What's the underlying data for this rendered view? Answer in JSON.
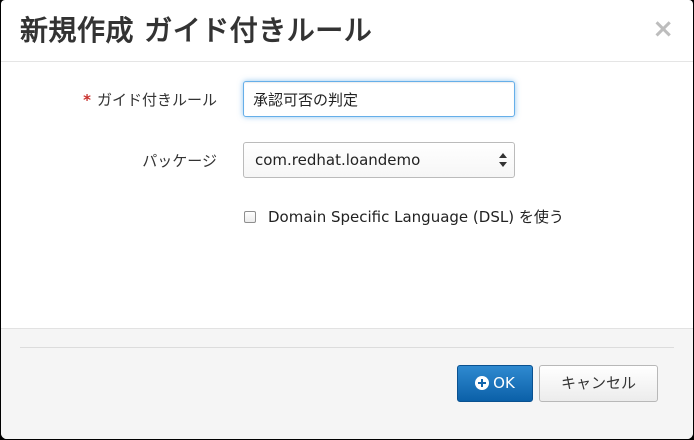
{
  "dialog": {
    "title": "新規作成 ガイド付きルール",
    "close_glyph": "×"
  },
  "form": {
    "required_mark": "*",
    "name_label": "ガイド付きルール",
    "name_value": "承認可否の判定",
    "package_label": "パッケージ",
    "package_value": "com.redhat.loandemo",
    "dsl_checkbox_label": "Domain Specific Language (DSL) を使う",
    "dsl_checked": false
  },
  "footer": {
    "ok_label": "OK",
    "cancel_label": "キャンセル"
  },
  "colors": {
    "primary": "#1a6fba",
    "required": "#c9302c",
    "focus": "#66afe9"
  },
  "icons": {
    "ok_icon": "plus-circle-icon",
    "select_icon": "select-arrows-icon",
    "close_icon": "close-icon"
  }
}
